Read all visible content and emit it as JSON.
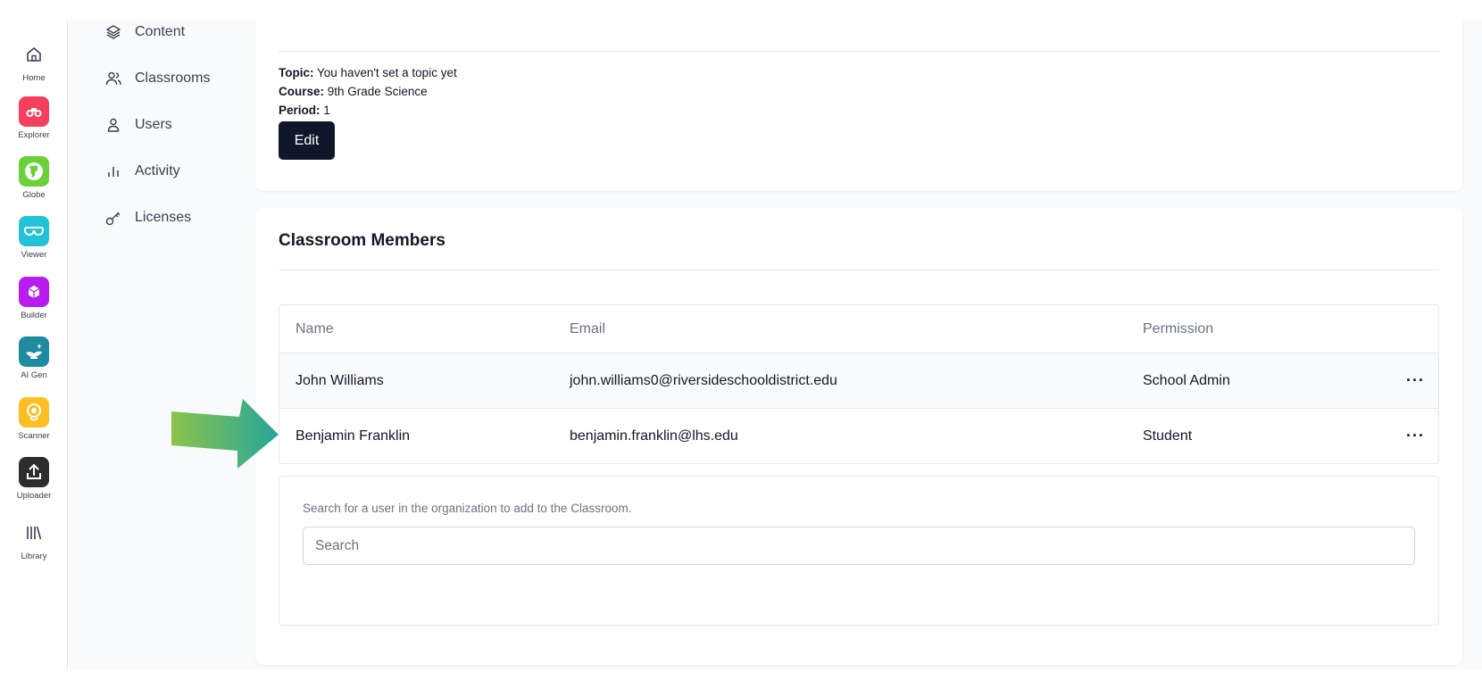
{
  "rail": {
    "items": [
      {
        "label": "Home",
        "icon": "home-icon"
      },
      {
        "label": "Explorer",
        "icon": "binoculars-icon",
        "color": "#f43f5e"
      },
      {
        "label": "Globe",
        "icon": "globe-icon",
        "color": "#6ad13b"
      },
      {
        "label": "Viewer",
        "icon": "glasses-icon",
        "color": "#22c3d6"
      },
      {
        "label": "Builder",
        "icon": "cube-icon",
        "color": "#b91cf0"
      },
      {
        "label": "AI Gen",
        "icon": "magic-lamp-icon",
        "color": "#1f8ba0"
      },
      {
        "label": "Scanner",
        "icon": "scanner-head-icon",
        "color": "#fbbf24"
      },
      {
        "label": "Uploader",
        "icon": "upload-icon",
        "color": "#2d2d2d"
      },
      {
        "label": "Library",
        "icon": "library-icon"
      }
    ]
  },
  "nav": {
    "items": [
      {
        "label": "Content",
        "icon": "layers-icon"
      },
      {
        "label": "Classrooms",
        "icon": "users-icon"
      },
      {
        "label": "Users",
        "icon": "user-icon"
      },
      {
        "label": "Activity",
        "icon": "bar-chart-icon"
      },
      {
        "label": "Licenses",
        "icon": "key-icon"
      }
    ]
  },
  "classroom": {
    "topic_label": "Topic:",
    "topic_value": "You haven't set a topic yet",
    "course_label": "Course:",
    "course_value": "9th Grade Science",
    "period_label": "Period:",
    "period_value": "1",
    "edit_label": "Edit"
  },
  "members": {
    "title": "Classroom Members",
    "columns": [
      "Name",
      "Email",
      "Permission"
    ],
    "rows": [
      {
        "name": "John Williams",
        "email": "john.williams0@riversideschooldistrict.edu",
        "permission": "School Admin",
        "menu": "···"
      },
      {
        "name": "Benjamin Franklin",
        "email": "benjamin.franklin@lhs.edu",
        "permission": "Student",
        "menu": "···"
      }
    ],
    "search_hint": "Search for a user in the organization to add to the Classroom.",
    "search_placeholder": "Search",
    "search_value": ""
  },
  "colors": {
    "primary_button": "#0f172a",
    "arrow_start": "#8bc34a",
    "arrow_end": "#26a69a"
  }
}
